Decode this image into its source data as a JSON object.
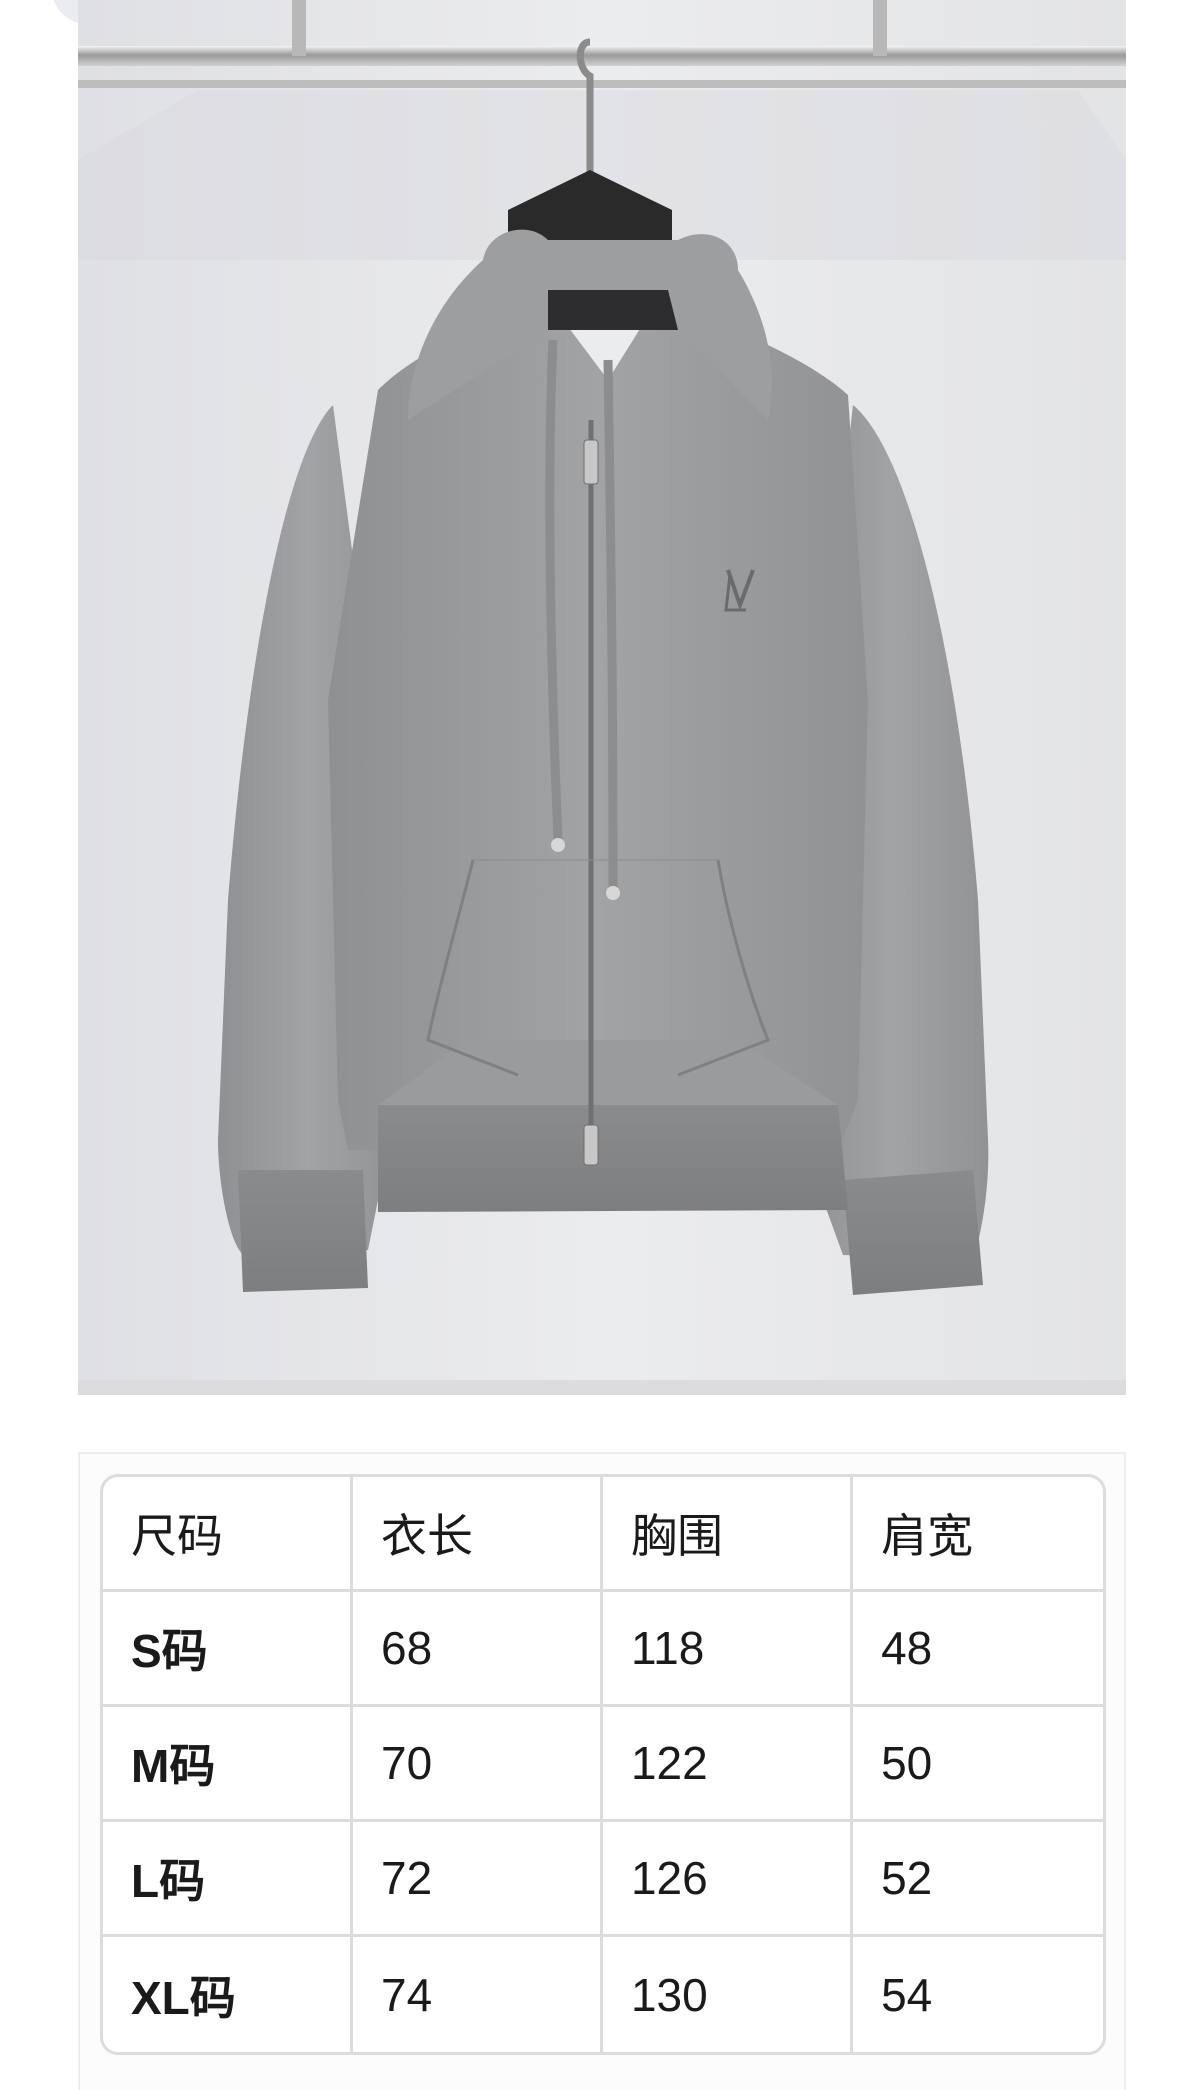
{
  "size_table": {
    "headers": [
      "尺码",
      "衣长",
      "胸围",
      "肩宽"
    ],
    "rows": [
      {
        "size": "S码",
        "length": "68",
        "chest": "118",
        "shoulder": "48"
      },
      {
        "size": "M码",
        "length": "70",
        "chest": "122",
        "shoulder": "50"
      },
      {
        "size": "L码",
        "length": "72",
        "chest": "126",
        "shoulder": "52"
      },
      {
        "size": "XL码",
        "length": "74",
        "chest": "130",
        "shoulder": "54"
      }
    ]
  },
  "product": {
    "color": "#9b9c9e",
    "logo_icon": "lv-monogram-icon"
  },
  "colors": {
    "table_border": "#dcdcdc",
    "photo_background": "#e7e8ea"
  }
}
